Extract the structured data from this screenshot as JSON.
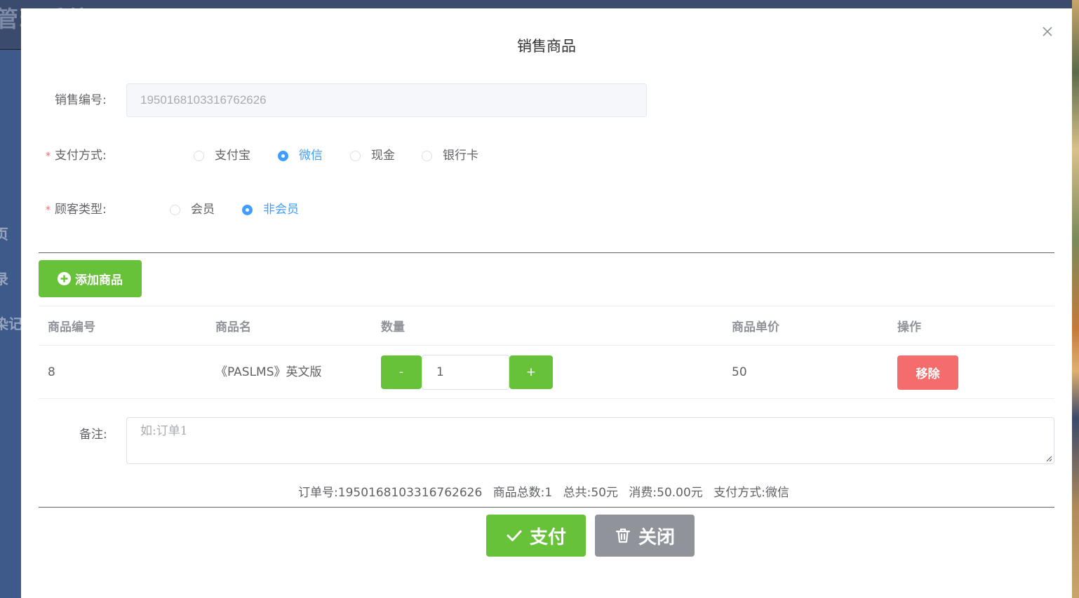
{
  "background": {
    "app_title": "管理系统",
    "side_items": [
      "页",
      "录",
      "染记"
    ]
  },
  "dialog": {
    "title": "销售商品",
    "close_icon": "close-icon"
  },
  "form": {
    "sale_no_label": "销售编号:",
    "sale_no_value": "1950168103316762626",
    "payment_label": "支付方式:",
    "payment_options": [
      "支付宝",
      "微信",
      "现金",
      "银行卡"
    ],
    "payment_selected": "微信",
    "customer_label": "顾客类型:",
    "customer_options": [
      "会员",
      "非会员"
    ],
    "customer_selected": "非会员",
    "required_mark": "*"
  },
  "toolbar": {
    "add_label": "添加商品",
    "add_icon": "circle-plus-icon"
  },
  "table": {
    "headers": [
      "商品编号",
      "商品名",
      "数量",
      "商品单价",
      "操作"
    ],
    "rows": [
      {
        "id": "8",
        "name": "《PASLMS》英文版",
        "minus": "-",
        "qty": "1",
        "plus": "+",
        "price": "50",
        "action": "移除"
      }
    ]
  },
  "remark": {
    "label": "备注:",
    "placeholder": "如:订单1"
  },
  "summary": {
    "order_no": "订单号:1950168103316762626",
    "total_count": "商品总数:1",
    "total": "总共:50元",
    "consume": "消费:50.00元",
    "payment": "支付方式:微信"
  },
  "footer": {
    "pay_label": "支付",
    "pay_icon": "check-icon",
    "close_label": "关闭",
    "close_icon": "trash-icon"
  },
  "colors": {
    "primary": "#409eff",
    "success": "#67c23a",
    "danger": "#f56c6c",
    "info": "#909399"
  }
}
